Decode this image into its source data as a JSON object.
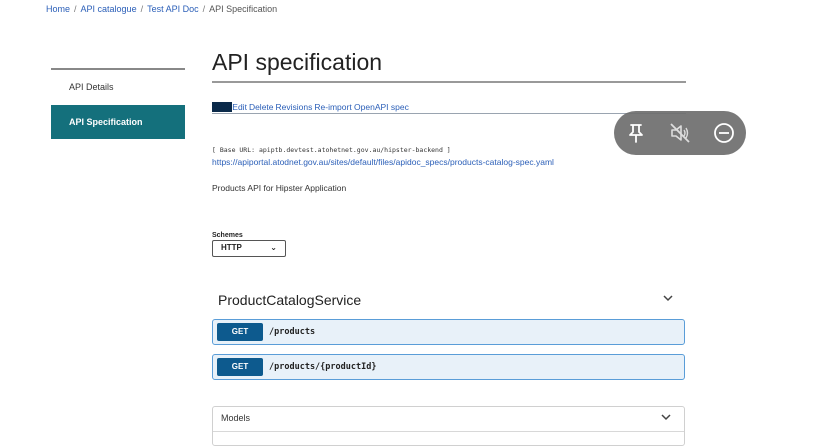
{
  "breadcrumb": {
    "items": [
      "Home",
      "API catalogue",
      "Test API Doc"
    ],
    "current": "API Specification",
    "separator": "/"
  },
  "sidebar": {
    "items": [
      {
        "label": "API Details",
        "active": false
      },
      {
        "label": "API Specification",
        "active": true
      }
    ]
  },
  "main": {
    "title": "API specification",
    "actions": {
      "view": "View",
      "edit": "Edit",
      "delete": "Delete",
      "revisions": "Revisions",
      "reimport": "Re-import OpenAPI spec"
    },
    "base_url": "[ Base URL: apiptb.devtest.atohetnet.gov.au/hipster-backend ]",
    "spec_link": "https://apiportal.atodnet.gov.au/sites/default/files/apidoc_specs/products-catalog-spec.yaml",
    "description": "Products API for Hipster Application",
    "schemes": {
      "label": "Schemes",
      "selected": "HTTP"
    },
    "service": {
      "name": "ProductCatalogService"
    },
    "operations": [
      {
        "method": "GET",
        "path": "/products"
      },
      {
        "method": "GET",
        "path": "/products/{productId}"
      }
    ],
    "models": {
      "label": "Models"
    }
  },
  "floating_toolbar": {
    "icons": [
      "pin-icon",
      "mute-icon",
      "minimize-icon"
    ]
  },
  "colors": {
    "accent_teal": "#14707c",
    "link_blue": "#2b5fb8",
    "get_method": "#0d5a8e",
    "op_background": "#e8f1f9",
    "op_border": "#5a9dd8"
  }
}
